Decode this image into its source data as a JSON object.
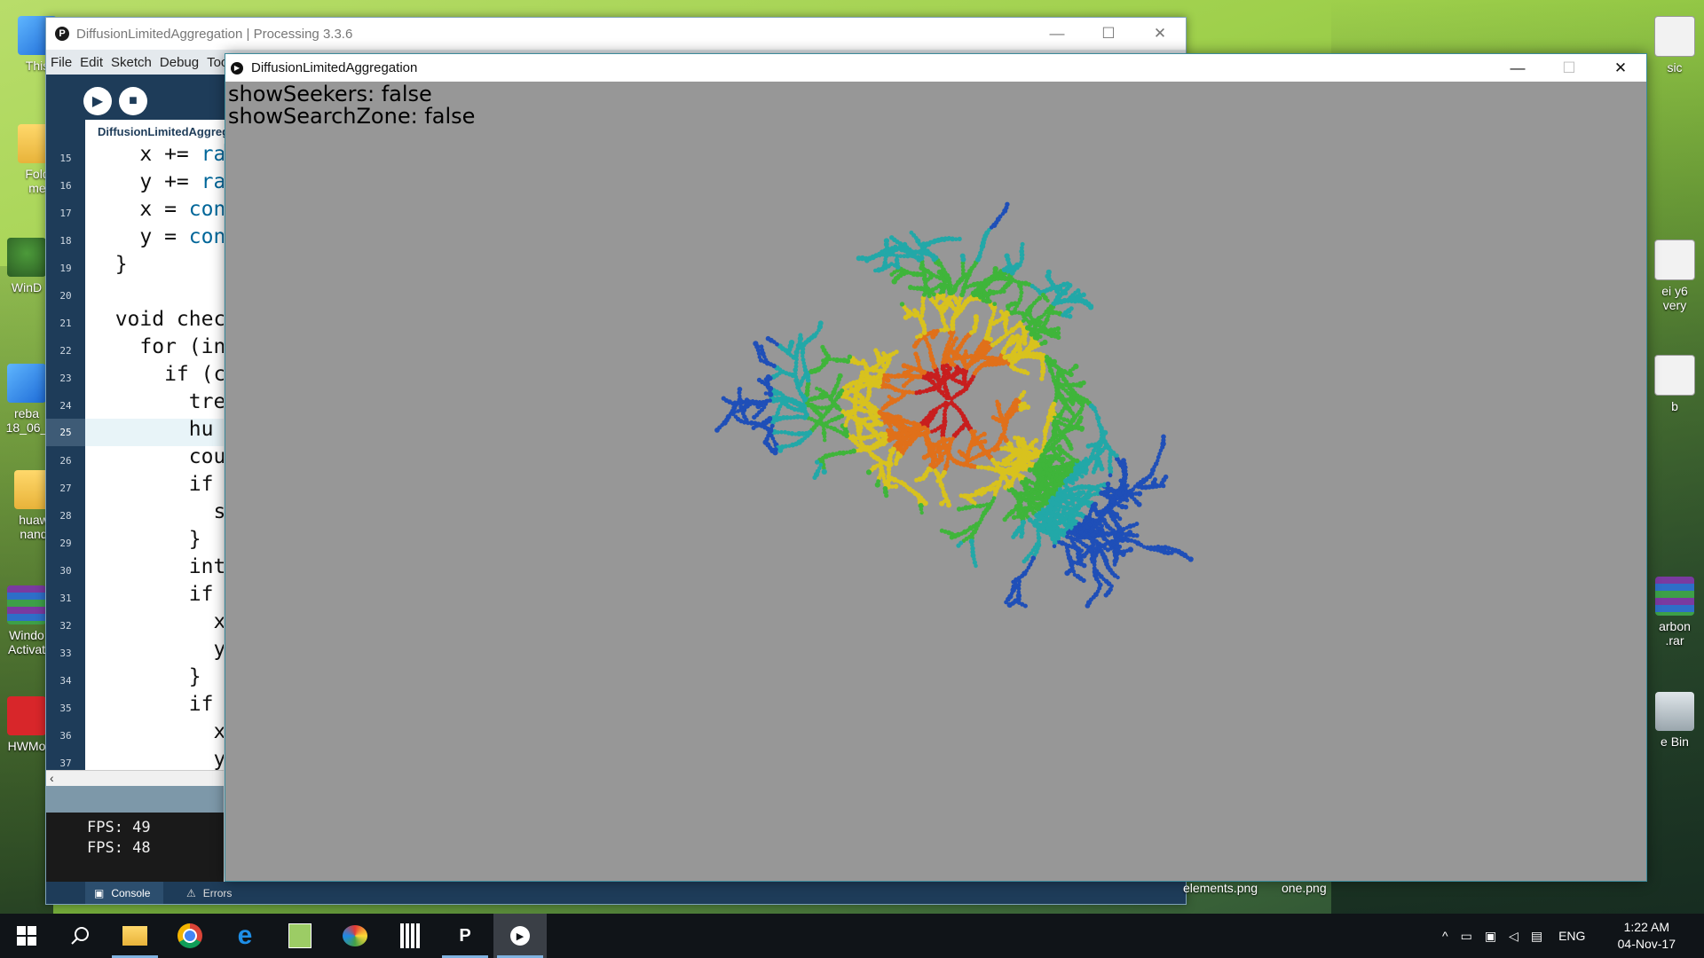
{
  "desktop": {
    "icons_left": [
      {
        "label": "This",
        "kind": "pc"
      },
      {
        "label": "Fold me",
        "kind": "folder"
      },
      {
        "label": "WinD",
        "kind": "tree"
      },
      {
        "label": "reba 18_06_",
        "kind": "cube"
      },
      {
        "label": "huaw nand",
        "kind": "folder"
      },
      {
        "label": "Windo Activat",
        "kind": "rar"
      },
      {
        "label": "HWMo",
        "kind": "red"
      }
    ],
    "icons_right": [
      {
        "label": "sic",
        "kind": "doc"
      },
      {
        "label": "ei y6 very",
        "kind": "doc"
      },
      {
        "label": "b",
        "kind": "doc"
      },
      {
        "label": "arbon .rar",
        "kind": "rar"
      },
      {
        "label": "e Bin",
        "kind": "bin"
      }
    ],
    "file_labels": [
      "elements.png",
      "one.png"
    ]
  },
  "ide": {
    "title": "DiffusionLimitedAggregation | Processing 3.3.6",
    "logo": "P",
    "menu": [
      "File",
      "Edit",
      "Sketch",
      "Debug",
      "Tool"
    ],
    "tab_label": "DiffusionLimitedAggreg",
    "code_lines": [
      {
        "n": "15",
        "text": "    x += ra"
      },
      {
        "n": "16",
        "text": "    y += ra"
      },
      {
        "n": "17",
        "text": "    x = con"
      },
      {
        "n": "18",
        "text": "    y = con"
      },
      {
        "n": "19",
        "text": "  }"
      },
      {
        "n": "20",
        "text": ""
      },
      {
        "n": "21",
        "text": "  void chec"
      },
      {
        "n": "22",
        "text": "    for (in"
      },
      {
        "n": "23",
        "text": "      if (c"
      },
      {
        "n": "24",
        "text": "        tre"
      },
      {
        "n": "25",
        "text": "        hu "
      },
      {
        "n": "26",
        "text": "        cou"
      },
      {
        "n": "27",
        "text": "        if "
      },
      {
        "n": "28",
        "text": "          s"
      },
      {
        "n": "29",
        "text": "        }"
      },
      {
        "n": "30",
        "text": "        int"
      },
      {
        "n": "31",
        "text": "        if "
      },
      {
        "n": "32",
        "text": "          x"
      },
      {
        "n": "33",
        "text": "          y"
      },
      {
        "n": "34",
        "text": "        }"
      },
      {
        "n": "35",
        "text": "        if "
      },
      {
        "n": "36",
        "text": "          x"
      },
      {
        "n": "37",
        "text": "          y"
      }
    ],
    "active_line": "25",
    "console_lines": [
      "FPS: 49",
      "FPS: 48"
    ],
    "bottom_tabs": {
      "console": "Console",
      "errors": "Errors"
    }
  },
  "sketch": {
    "title": "DiffusionLimitedAggregation",
    "hud": {
      "line1": "showSeekers: false",
      "line2": "showSearchZone: false"
    },
    "canvas_color": "#979797",
    "fractal": {
      "arms": 6,
      "colors": [
        "#c81e1e",
        "#e0701a",
        "#d8c21e",
        "#3fb53a",
        "#22a8a8",
        "#1f4fb8"
      ]
    }
  },
  "taskbar": {
    "apps": [
      "start",
      "search",
      "file-explorer",
      "chrome",
      "edge",
      "notepad",
      "paint",
      "calculator",
      "processing",
      "sketch-run"
    ],
    "tray": {
      "lang": "ENG",
      "time": "1:22 AM",
      "date": "04-Nov-17"
    }
  }
}
